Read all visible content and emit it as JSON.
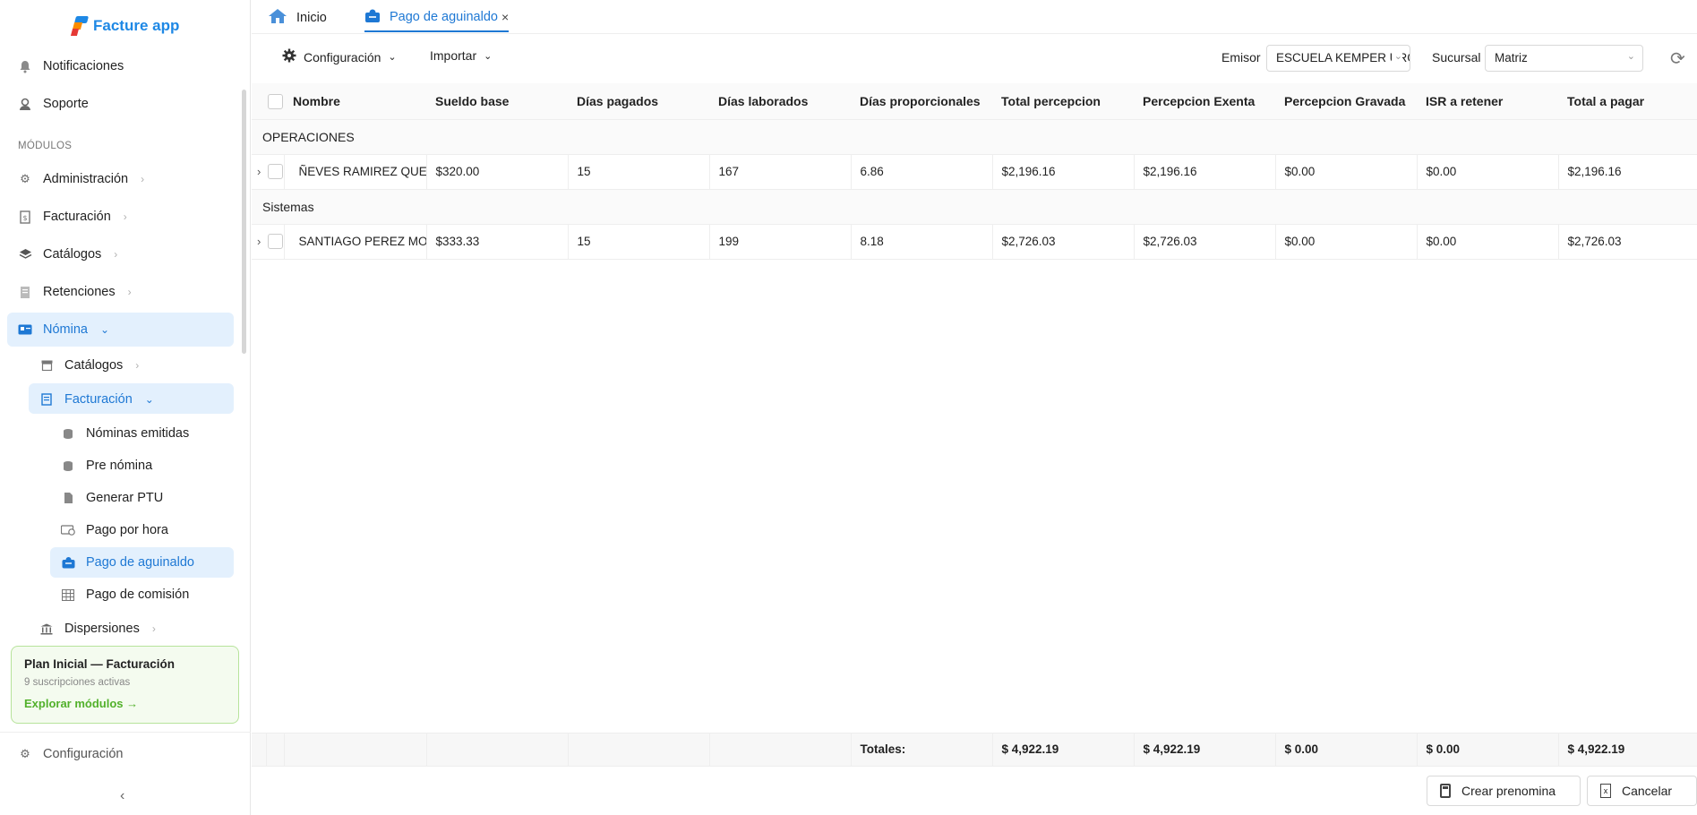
{
  "app": {
    "name": "Facture app"
  },
  "sidebar": {
    "top_items": [
      {
        "label": "Notificaciones",
        "icon": "bell-icon"
      },
      {
        "label": "Soporte",
        "icon": "user-icon"
      }
    ],
    "section_label": "MÓDULOS",
    "modules": [
      {
        "label": "Administración",
        "icon": "gears-icon"
      },
      {
        "label": "Facturación",
        "icon": "invoice-icon"
      },
      {
        "label": "Catálogos",
        "icon": "layers-icon"
      },
      {
        "label": "Retenciones",
        "icon": "document-icon"
      },
      {
        "label": "Nómina",
        "icon": "id-card-icon",
        "expanded": true
      }
    ],
    "nomina_children": [
      {
        "label": "Catálogos",
        "icon": "archive-icon"
      },
      {
        "label": "Facturación",
        "icon": "document-icon",
        "expanded": true
      }
    ],
    "facturacion_children": [
      {
        "label": "Nóminas emitidas",
        "icon": "database-icon"
      },
      {
        "label": "Pre nómina",
        "icon": "database-icon"
      },
      {
        "label": "Generar PTU",
        "icon": "file-icon"
      },
      {
        "label": "Pago por hora",
        "icon": "card-clock-icon"
      },
      {
        "label": "Pago de aguinaldo",
        "icon": "gift-box-icon",
        "active": true
      },
      {
        "label": "Pago de comisión",
        "icon": "grid-icon"
      }
    ],
    "dispersiones": {
      "label": "Dispersiones",
      "icon": "bank-icon"
    },
    "plan": {
      "title": "Plan Inicial — Facturación",
      "subtitle": "9 suscripciones activas",
      "link": "Explorar módulos →"
    },
    "settings": "Configuración",
    "collapse_icon": "chevron-left-icon"
  },
  "tabs": [
    {
      "label": "Inicio",
      "icon": "home-icon"
    },
    {
      "label": "Pago de aguinaldo",
      "icon": "gift-box-icon",
      "close": "×",
      "active": true
    }
  ],
  "toolbar": {
    "config_label": "Configuración",
    "import_label": "Importar",
    "emisor_label": "Emisor",
    "emisor_value": "ESCUELA KEMPER URGATE",
    "sucursal_label": "Sucursal",
    "sucursal_value": "Matriz"
  },
  "table": {
    "columns": [
      "Nombre",
      "Sueldo base",
      "Días pagados",
      "Días laborados",
      "Días proporcionales",
      "Total percepcion",
      "Percepcion Exenta",
      "Percepcion Gravada",
      "ISR a retener",
      "Total a pagar"
    ],
    "groups": [
      {
        "name": "OPERACIONES",
        "rows": [
          [
            "ÑEVES RAMIREZ QUEZADA",
            "$320.00",
            "15",
            "167",
            "6.86",
            "$2,196.16",
            "$2,196.16",
            "$0.00",
            "$0.00",
            "$2,196.16"
          ]
        ]
      },
      {
        "name": "Sistemas",
        "rows": [
          [
            "SANTIAGO PEREZ MONTES",
            "$333.33",
            "15",
            "199",
            "8.18",
            "$2,726.03",
            "$2,726.03",
            "$0.00",
            "$0.00",
            "$2,726.03"
          ]
        ]
      }
    ],
    "totals_label": "Totales:",
    "totals": [
      "$ 4,922.19",
      "$ 4,922.19",
      "$ 0.00",
      "$ 0.00",
      "$ 4,922.19"
    ]
  },
  "footer": {
    "create_label": "Crear prenomina",
    "cancel_label": "Cancelar"
  },
  "colors": {
    "accent": "#1e78d4",
    "highlight": "#e3f0fd",
    "plan_green": "#52b12b"
  }
}
